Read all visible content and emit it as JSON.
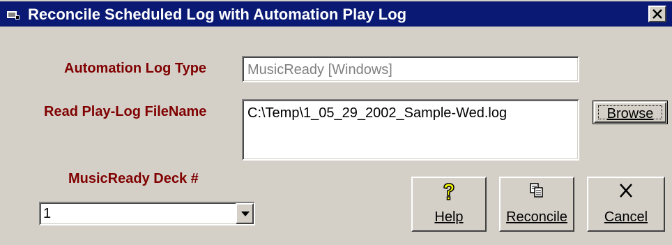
{
  "window": {
    "title": "Reconcile Scheduled Log with Automation Play Log"
  },
  "form": {
    "log_type_label": "Automation Log Type",
    "log_type_value": "MusicReady [Windows]",
    "filename_label": "Read Play-Log FileName",
    "filename_value": "C:\\Temp\\1_05_29_2002_Sample-Wed.log",
    "deck_label": "MusicReady Deck #",
    "deck_value": "1"
  },
  "buttons": {
    "browse_label": "Browse",
    "help_label": "Help",
    "reconcile_label": "Reconcile",
    "cancel_label": "Cancel"
  },
  "colors": {
    "titlebar": "#0a1a74",
    "label": "#800000",
    "face": "#d4d0c8",
    "help_icon": "#ffff00"
  },
  "icons": {
    "title": "app-icon",
    "close": "close-icon",
    "help": "question-mark-icon",
    "reconcile": "copy-icon",
    "cancel": "x-icon",
    "dropdown": "dropdown-arrow-icon"
  }
}
